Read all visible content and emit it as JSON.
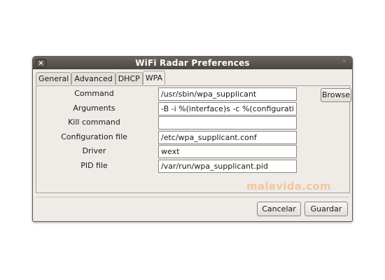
{
  "window": {
    "title": "WiFi Radar Preferences",
    "close_icon": "×",
    "maximize_icon": "◦"
  },
  "tabs": [
    {
      "label": "General"
    },
    {
      "label": "Advanced"
    },
    {
      "label": "DHCP"
    },
    {
      "label": "WPA"
    }
  ],
  "active_tab": "WPA",
  "fields": [
    {
      "label": "Command",
      "value": "/usr/sbin/wpa_supplicant"
    },
    {
      "label": "Arguments",
      "value": "-B -i %(interface)s -c %(configuration)s"
    },
    {
      "label": "Kill command",
      "value": ""
    },
    {
      "label": "Configuration file",
      "value": "/etc/wpa_supplicant.conf"
    },
    {
      "label": "Driver",
      "value": "wext"
    },
    {
      "label": "PID file",
      "value": "/var/run/wpa_supplicant.pid"
    }
  ],
  "browse_label": "Browse",
  "buttons": {
    "cancel": "Cancelar",
    "save": "Guardar"
  },
  "watermark": "malavida.com",
  "colors": {
    "titlebar": "#4b4741",
    "window_bg": "#efebe7",
    "watermark": "#f0c79f"
  }
}
